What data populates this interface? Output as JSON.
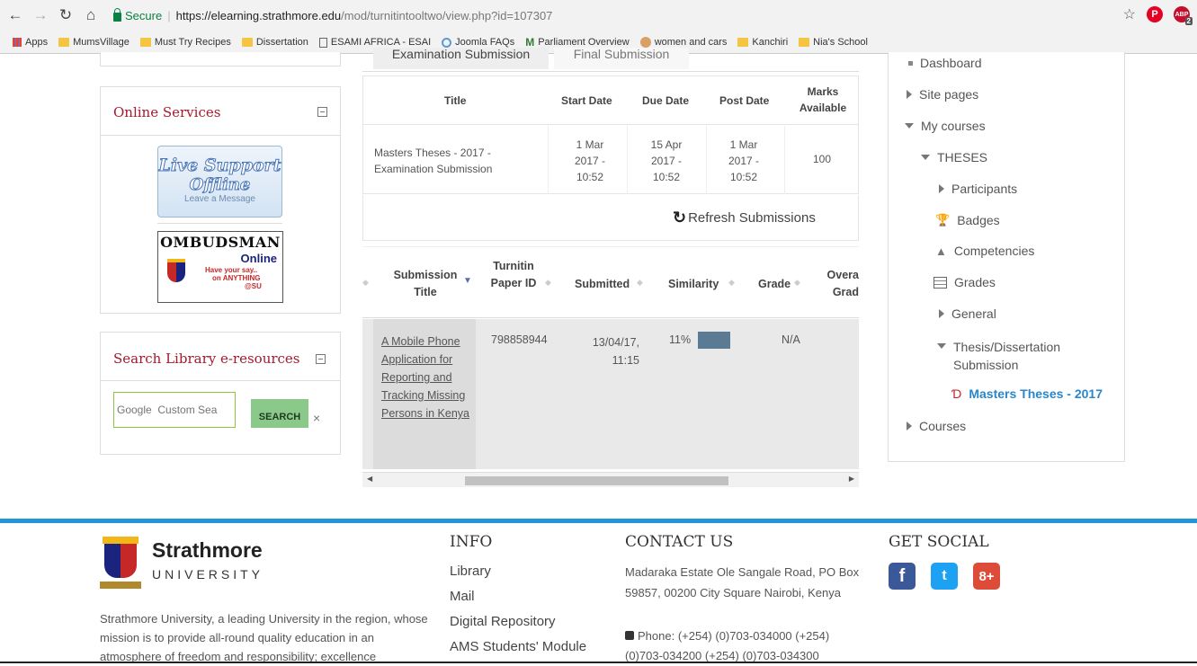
{
  "browser": {
    "secure_label": "Secure",
    "url_host": "https://elearning.strathmore.edu",
    "url_path": "/mod/turnitintooltwo/view.php?id=107307",
    "pinterest_label": "P",
    "abp_label": "ABP",
    "abp_badge": "2",
    "bookmarks": [
      "Apps",
      "MumsVillage",
      "Must Try Recipes",
      "Dissertation",
      "ESAMI AFRICA - ESAI",
      "Joomla FAQs",
      "Parliament Overview",
      "women and cars",
      "Kanchiri",
      "Nia's School"
    ]
  },
  "left": {
    "online_services_title": "Online Services",
    "live_support": {
      "line1": "Live Support",
      "line2": "Offline",
      "line3": "Leave a Message"
    },
    "ombudsman": {
      "line1": "OMBUDSMAN",
      "line2": "Online",
      "line3": "Have your say..",
      "line4": "on ANYTHING",
      "line5": "@SU"
    },
    "search_title": "Search Library e-resources",
    "search_placeholder": "Google  Custom Sea",
    "search_button": "SEARCH",
    "search_clear": "×"
  },
  "main": {
    "tabs": [
      "Examination Submission",
      "Final Submission"
    ],
    "assign_headers": [
      "Title",
      "Start Date",
      "Due Date",
      "Post Date",
      "Marks Available"
    ],
    "assign_row": {
      "title": "Masters Theses - 2017 - Examination Submission",
      "start": "1 Mar 2017 - 10:52",
      "due": "15 Apr 2017 - 10:52",
      "post": "1 Mar 2017 - 10:52",
      "marks": "100"
    },
    "refresh_label": "Refresh Submissions",
    "subm_headers": [
      "Submission Title",
      "Turnitin Paper ID",
      "Submitted",
      "Similarity",
      "Grade",
      "Overa Grad"
    ],
    "subm_row": {
      "title": "A Mobile Phone Application for Reporting and Tracking Missing Persons in Kenya",
      "paper_id": "798858944",
      "submitted": "13/04/17, 11:15",
      "similarity": "11%",
      "similarity_fraction": 0.11,
      "similarity_color": "#5b7a94",
      "grade": "N/A"
    }
  },
  "nav": {
    "dashboard": "Dashboard",
    "site_pages": "Site pages",
    "my_courses": "My courses",
    "theses": "THESES",
    "participants": "Participants",
    "badges": "Badges",
    "competencies": "Competencies",
    "grades": "Grades",
    "general": "General",
    "thesis_submission": "Thesis/Dissertation Submission",
    "masters": "Masters Theses - 2017",
    "courses": "Courses"
  },
  "footer": {
    "brand_name": "Strathmore",
    "brand_sub": "UNIVERSITY",
    "about": "Strathmore University, a leading University in the region, whose mission is to provide all-round quality education in an atmosphere of freedom and responsibility; excellence",
    "info_title": "INFO",
    "info_links": [
      "Library",
      "Mail",
      "Digital Repository",
      "AMS Students' Module"
    ],
    "contact_title": "CONTACT US",
    "contact_address": "Madaraka Estate Ole Sangale Road, PO Box 59857, 00200 City Square Nairobi, Kenya",
    "contact_phone": "Phone: (+254) (0)703-034000 (+254) (0)703-034200 (+254) (0)703-034300",
    "social_title": "GET SOCIAL",
    "social": [
      "f",
      "t",
      "8+"
    ],
    "colors": {
      "accent": "#2196d6",
      "brand_red": "#a6192e",
      "facebook": "#3b5998",
      "twitter": "#1da1f2",
      "google": "#dd4b39"
    }
  }
}
